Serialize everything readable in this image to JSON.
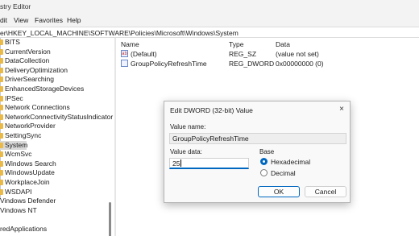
{
  "window": {
    "title": "stry Editor"
  },
  "menu": [
    "dit",
    "View",
    "Favorites",
    "Help"
  ],
  "address": {
    "path": "er\\HKEY_LOCAL_MACHINE\\SOFTWARE\\Policies\\Microsoft\\Windows\\System"
  },
  "tree": {
    "items": [
      {
        "label": "BITS",
        "indent": true,
        "selected": false
      },
      {
        "label": "CurrentVersion",
        "indent": true,
        "selected": false
      },
      {
        "label": "DataCollection",
        "indent": true,
        "selected": false
      },
      {
        "label": "DeliveryOptimization",
        "indent": true,
        "selected": false
      },
      {
        "label": "DriverSearching",
        "indent": true,
        "selected": false
      },
      {
        "label": "EnhancedStorageDevices",
        "indent": true,
        "selected": false
      },
      {
        "label": "IPSec",
        "indent": true,
        "selected": false
      },
      {
        "label": "Network Connections",
        "indent": true,
        "selected": false
      },
      {
        "label": "NetworkConnectivityStatusIndicator",
        "indent": true,
        "selected": false
      },
      {
        "label": "NetworkProvider",
        "indent": true,
        "selected": false
      },
      {
        "label": "SettingSync",
        "indent": true,
        "selected": false
      },
      {
        "label": "System",
        "indent": true,
        "selected": true
      },
      {
        "label": "WcmSvc",
        "indent": true,
        "selected": false
      },
      {
        "label": "Windows Search",
        "indent": true,
        "selected": false
      },
      {
        "label": "WindowsUpdate",
        "indent": true,
        "selected": false
      },
      {
        "label": "WorkplaceJoin",
        "indent": true,
        "selected": false
      },
      {
        "label": "WSDAPI",
        "indent": true,
        "selected": false
      },
      {
        "label": "Vindows Defender",
        "indent": false,
        "selected": false
      },
      {
        "label": "Vindows NT",
        "indent": false,
        "selected": false
      },
      {
        "label": "",
        "indent": false,
        "selected": false
      },
      {
        "label": "redApplications",
        "indent": false,
        "selected": false
      }
    ]
  },
  "values_pane": {
    "columns": [
      "Name",
      "Type",
      "Data"
    ],
    "rows": [
      {
        "icon": "string-value-icon",
        "icon_glyph": "ab",
        "name": "(Default)",
        "type": "REG_SZ",
        "data": "(value not set)"
      },
      {
        "icon": "binary-value-icon",
        "icon_glyph": "",
        "name": "GroupPolicyRefreshTime",
        "type": "REG_DWORD",
        "data": "0x00000000 (0)"
      }
    ]
  },
  "dialog": {
    "title": "Edit DWORD (32-bit) Value",
    "close_glyph": "×",
    "value_name_label": "Value name:",
    "value_name": "GroupPolicyRefreshTime",
    "value_data_label": "Value data:",
    "value_data": "25",
    "base_label": "Base",
    "radios": [
      {
        "label": "Hexadecimal",
        "checked": true
      },
      {
        "label": "Decimal",
        "checked": false
      }
    ],
    "ok_label": "OK",
    "cancel_label": "Cancel"
  },
  "colors": {
    "accent": "#0067c0",
    "selection": "#d9d9d9",
    "folder": "#e9b949"
  }
}
